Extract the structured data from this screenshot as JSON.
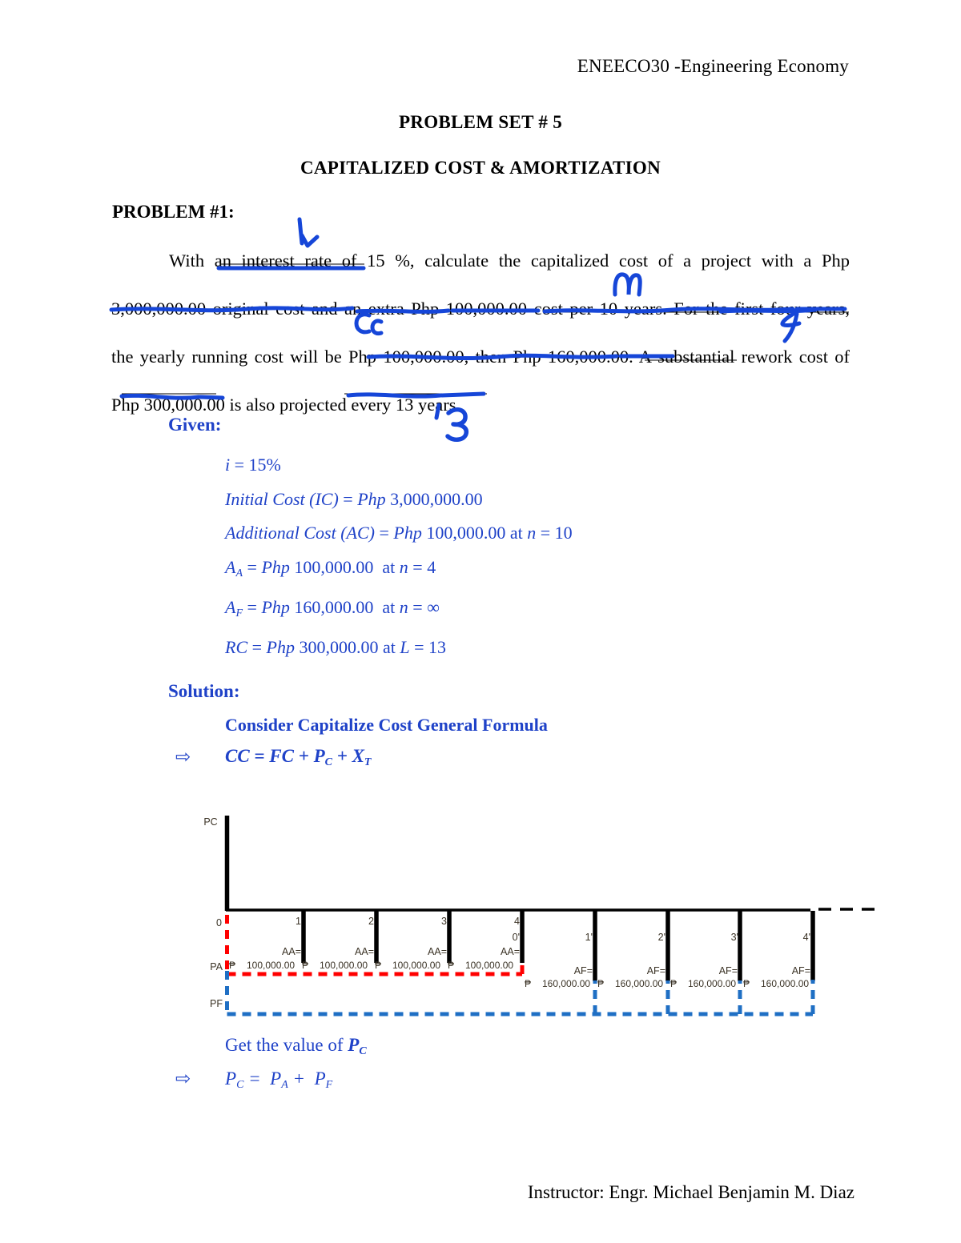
{
  "header": {
    "course": "ENEECO30 -Engineering Economy"
  },
  "titles": {
    "line1": "PROBLEM SET # 5",
    "line2": "CAPITALIZED COST & AMORTIZATION"
  },
  "problem": {
    "label": "PROBLEM #1:"
  },
  "body": {
    "line1": "With an interest rate of 15 %, calculate the capitalized cost of a project with a Php",
    "line2": "3,000,000.00 original cost and an extra Php 100,000.00 cost per 10 years. For the first four years,",
    "line3": "the yearly running cost will be Php 100,000.00, then Php 160,000.00. A substantial rework cost of",
    "line4": "Php 300,000.00 is also projected every 13 years."
  },
  "given": {
    "heading": "Given:",
    "items": [
      {
        "lhs": "i",
        "rhs": "= 15%"
      },
      {
        "lhs": "Initial Cost (IC)",
        "rhs": "= Php 3,000,000.00"
      },
      {
        "lhs": "Additional Cost (AC)",
        "rhs": "= Php 100,000.00 at n = 10"
      },
      {
        "lhs": "A_A",
        "rhs": "= Php 100,000.00  at n = 4"
      },
      {
        "lhs": "A_F",
        "rhs": "= Php 160,000.00  at n = ∞"
      },
      {
        "lhs": "RC",
        "rhs": "= Php 300,000.00 at L = 13"
      }
    ],
    "i_value": "15%",
    "initial_cost": "Php 3,000,000.00",
    "additional_cost": "Php 100,000.00",
    "additional_cost_n": "10",
    "AA": "Php 100,000.00",
    "AA_n": "4",
    "AF": "Php 160,000.00",
    "AF_n": "∞",
    "RC": "Php 300,000.00",
    "RC_L": "13"
  },
  "solution": {
    "heading": "Solution:",
    "subheading": "Consider Capitalize Cost General Formula",
    "formula1": "CC = FC + Pᴄ + Xₜ",
    "get_value_label": "Get the value of",
    "get_value_symbol": "Pᴄ",
    "formula2": "Pᴄ =  Pᴀ +  Pꜰ",
    "bullet": "⇨"
  },
  "annotations": [
    {
      "name": "check-mark-interest",
      "glyph": "l↙"
    },
    {
      "name": "n-mark-10-years",
      "glyph": "n"
    },
    {
      "name": "cc-mark-running-cost",
      "glyph": "Cc"
    },
    {
      "name": "four-mark-rework",
      "glyph": "4"
    },
    {
      "name": "thirteen-mark-years",
      "glyph": "'3"
    }
  ],
  "diagram": {
    "labels": {
      "PC": "PC",
      "PA": "PA",
      "PF": "PF",
      "zero": "0",
      "AA_tag": "AA=",
      "AF_tag": "AF=",
      "peso": "₱"
    },
    "periods_primary": [
      "0",
      "1",
      "2",
      "3",
      "4"
    ],
    "periods_secondary": [
      "0'",
      "1'",
      "2'",
      "3'",
      "4'"
    ],
    "aa_flows": [
      {
        "tag": "AA=",
        "peso": "₱",
        "amount": "100,000.00"
      },
      {
        "tag": "AA=",
        "peso": "₱",
        "amount": "100,000.00"
      },
      {
        "tag": "AA=",
        "peso": "₱",
        "amount": "100,000.00"
      },
      {
        "tag": "AA=",
        "peso": "₱",
        "amount": "100,000.00"
      }
    ],
    "af_flows": [
      {
        "tag": "AF=",
        "peso": "₱",
        "amount": "160,000.00"
      },
      {
        "tag": "AF=",
        "peso": "₱",
        "amount": "160,000.00"
      },
      {
        "tag": "AF=",
        "peso": "₱",
        "amount": "160,000.00"
      },
      {
        "tag": "AF=",
        "peso": "₱",
        "amount": "160,000.00"
      }
    ],
    "colors": {
      "axis": "#000000",
      "pa_bracket": "#FF0000",
      "pf_bracket": "#1F6FC4",
      "text": "#3b3326"
    }
  },
  "footer": {
    "instructor": "Instructor: Engr. Michael Benjamin M. Diaz"
  }
}
